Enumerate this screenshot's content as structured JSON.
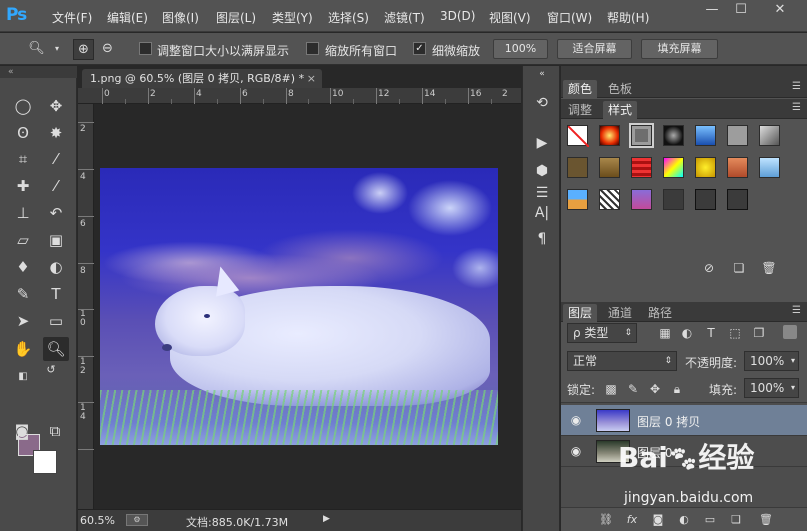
{
  "app": {
    "logo": "Ps"
  },
  "menu": [
    "文件(F)",
    "编辑(E)",
    "图像(I)",
    "图层(L)",
    "类型(Y)",
    "选择(S)",
    "滤镜(T)",
    "3D(D)",
    "视图(V)",
    "窗口(W)",
    "帮助(H)"
  ],
  "window_controls": {
    "minimize": "—",
    "restore": "☐",
    "close": "✕"
  },
  "options": {
    "checkbox_resize_windows": {
      "label": "调整窗口大小以满屏显示",
      "checked": false
    },
    "checkbox_zoom_all": {
      "label": "缩放所有窗口",
      "checked": false
    },
    "checkbox_scrubby": {
      "label": "细微缩放",
      "checked": true
    },
    "btn_100": "100%",
    "btn_fit_screen": "适合屏幕",
    "btn_fill_screen": "填充屏幕"
  },
  "document": {
    "tab_title": "1.png @ 60.5% (图层 0 拷贝, RGB/8#) *",
    "tab_close": "×",
    "ruler_h": [
      "0",
      "2",
      "4",
      "6",
      "8",
      "10",
      "12",
      "14",
      "16",
      "18",
      "2"
    ],
    "ruler_v": [
      "2",
      "4",
      "6",
      "8",
      "1 0",
      "1 2",
      "1 4"
    ]
  },
  "status": {
    "zoom": "60.5%",
    "doc_size": "文档:885.0K/1.73M"
  },
  "panels": {
    "color_tabs": [
      "颜色",
      "色板"
    ],
    "style_tabs": [
      "调整",
      "样式"
    ],
    "layers_tabs": [
      "图层",
      "通道",
      "路径"
    ],
    "filter_kind": "ρ 类型",
    "blend_mode": "正常",
    "opacity_label": "不透明度:",
    "opacity_value": "100%",
    "lock_label": "锁定:",
    "fill_label": "填充:",
    "fill_value": "100%"
  },
  "layers": [
    {
      "name": "图层 0 拷贝",
      "visible": true,
      "selected": true
    },
    {
      "name": "图层 0",
      "visible": true,
      "selected": false
    }
  ],
  "watermark": {
    "logo": "Bai 经验",
    "url": "jingyan.baidu.com"
  },
  "colors": {
    "foreground": "#8a6a8a",
    "background": "#ffffff",
    "selected_layer": "#6f8097"
  }
}
